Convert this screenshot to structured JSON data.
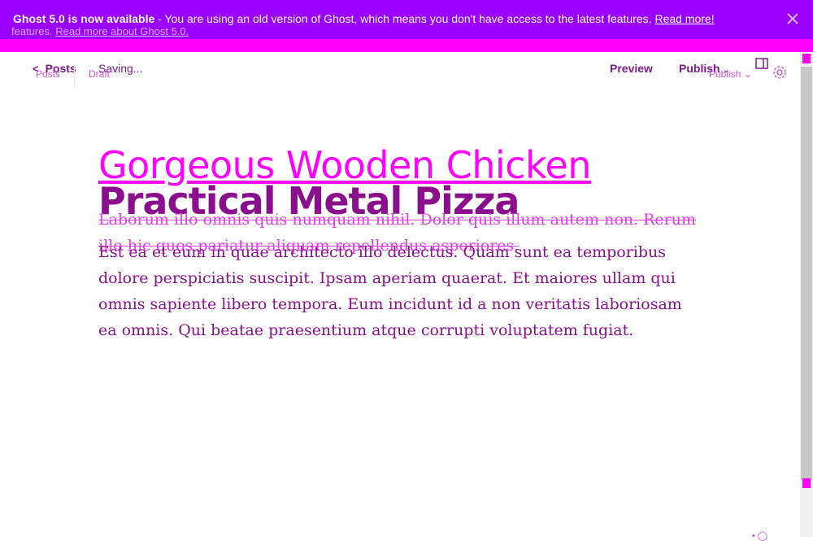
{
  "banner": {
    "bold": "Ghost 5.0 is now available",
    "message": " - You are using an old version of Ghost, which means you don't have access to the latest features.",
    "link": "Read more!",
    "ghost_line_prefix": "features.",
    "ghost_line_link": "Read more about Ghost 5.0."
  },
  "toolbar": {
    "back_label": "Posts",
    "back_ghost": "Posts",
    "status": "Saving...",
    "status_ghost": "Draft",
    "preview": "Preview",
    "publish": "Publish",
    "publish_ghost": "Publish"
  },
  "post": {
    "title_ghost": "Gorgeous Wooden Chicken",
    "title": "Practical Metal Pizza",
    "excerpt_ghost": "Laborum illo omnis quis numquam nihil. Dolor quis illum autem non. Rerum illo hic quos pariatur aliquam repellendus asperiores.",
    "body": "Est ea et eum in quae architecto illo delectus. Quam sunt ea temporibus dolore perspiciatis suscipit. Ipsam aperiam quaerat. Et maiores ullam qui omnis sapiente libero tempora. Eum incidunt id a non veritatis laboriosam ea omnis. Qui beatae praesentium atque corrupti voluptatem fugiat."
  },
  "colors": {
    "banner_bg": "#9900ff",
    "accent_magenta": "#ff00ff",
    "text_purple": "#8a0f8c"
  },
  "icons": {
    "back": "chevron-left-icon",
    "publish_chevron": "chevron-down-icon",
    "sidebar": "sidebar-toggle-icon",
    "settings": "gear-icon",
    "close": "close-icon"
  }
}
